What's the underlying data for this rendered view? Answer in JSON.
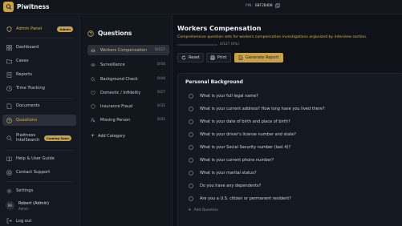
{
  "app": {
    "name": "Piwitness"
  },
  "pin": {
    "label": "PIN:",
    "value": "6BF2B4D8"
  },
  "sidebar": {
    "admin": {
      "label": "Admin Panel",
      "badge": "Admin"
    },
    "items": [
      {
        "label": "Dashboard",
        "icon": "grid-icon"
      },
      {
        "label": "Cases",
        "icon": "folder-icon"
      },
      {
        "label": "Reports",
        "icon": "document-icon"
      },
      {
        "label": "Time Tracking",
        "icon": "clock-icon"
      },
      {
        "label": "Documents",
        "icon": "file-icon"
      },
      {
        "label": "Questions",
        "icon": "help-circle-icon"
      },
      {
        "label": "Piwitness IntelSearch",
        "icon": "search-icon",
        "badge": "Coming Soon"
      },
      {
        "label": "Help & User Guide",
        "icon": "book-icon"
      },
      {
        "label": "Contact Support",
        "icon": "life-ring-icon"
      },
      {
        "label": "Settings",
        "icon": "gear-icon"
      }
    ],
    "user": {
      "initials": "RA",
      "name": "Robert (Admin)",
      "role": "Admin"
    },
    "logout": "Log out"
  },
  "questions_panel": {
    "title": "Questions",
    "categories": [
      {
        "label": "Workers Compensation",
        "count": "0/127"
      },
      {
        "label": "Surveillance",
        "count": "0/44"
      },
      {
        "label": "Background Check",
        "count": "0/44"
      },
      {
        "label": "Domestic / Infidelity",
        "count": "0/27"
      },
      {
        "label": "Insurance Fraud",
        "count": "0/31"
      },
      {
        "label": "Missing Person",
        "count": "0/41"
      }
    ],
    "add_category": "Add Category"
  },
  "main": {
    "title": "Workers Compensation",
    "description": "Comprehensive question sets for workers compensation investigations organized by interview section.",
    "progress": {
      "answered": 0,
      "total": 127,
      "fraction": 0.0,
      "text": "0/127 (0%)"
    },
    "buttons": {
      "reset": "Reset",
      "print": "Print",
      "generate": "Generate Report"
    },
    "section": {
      "title": "Personal Background",
      "questions": [
        "What is your full legal name?",
        "What is your current address? How long have you lived there?",
        "What is your date of birth and place of birth?",
        "What is your driver's license number and state?",
        "What is your Social Security number (last 4)?",
        "What is your current phone number?",
        "What is your marital status?",
        "Do you have any dependents?",
        "Are you a U.S. citizen or permanent resident?"
      ],
      "add_question": "Add Question"
    }
  },
  "colors": {
    "accent": "#d7b45b",
    "background": "#0f1218",
    "sidebar": "#141820"
  }
}
